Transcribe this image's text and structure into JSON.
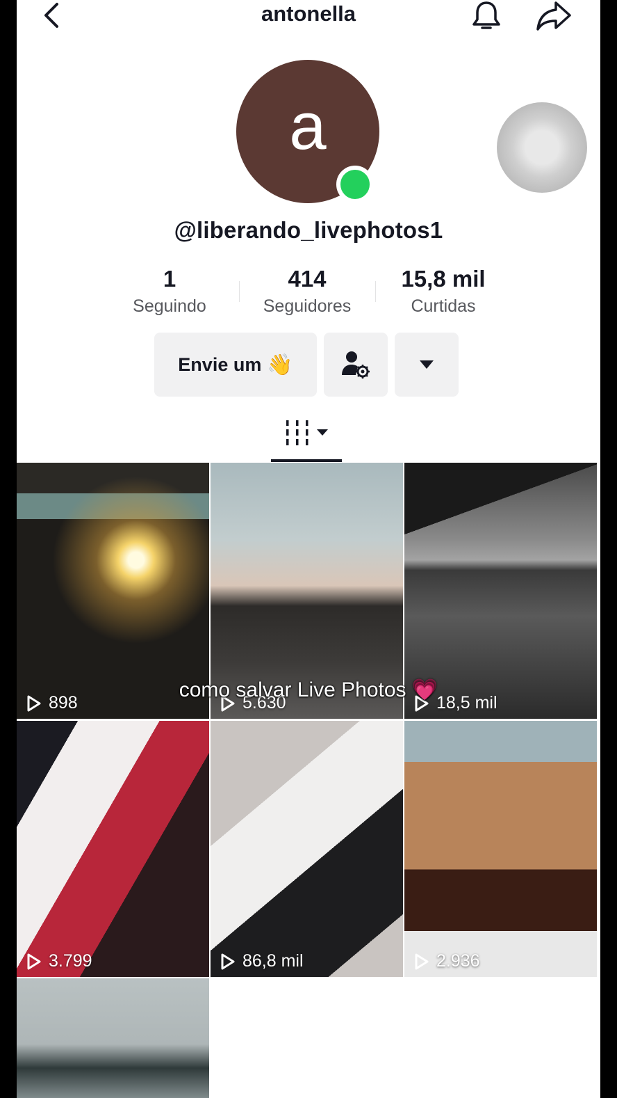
{
  "header": {
    "title": "antonella"
  },
  "profile": {
    "avatar_letter": "a",
    "handle": "@liberando_livephotos1",
    "stats": [
      {
        "value": "1",
        "label": "Seguindo"
      },
      {
        "value": "414",
        "label": "Seguidores"
      },
      {
        "value": "15,8 mil",
        "label": "Curtidas"
      }
    ]
  },
  "actions": {
    "message_label": "Envie um",
    "message_emoji": "👋"
  },
  "videos": [
    {
      "views": "898"
    },
    {
      "views": "5.630"
    },
    {
      "views": "18,5 mil"
    },
    {
      "views": "3.799"
    },
    {
      "views": "86,8 mil"
    },
    {
      "views": "2.936"
    },
    {
      "views": ""
    }
  ],
  "overlay_caption": "como salvar Live Photos 💗",
  "colors": {
    "avatar_bg": "#5b3933",
    "online": "#23d05c",
    "text": "#161823",
    "button_bg": "#f1f1f2"
  }
}
